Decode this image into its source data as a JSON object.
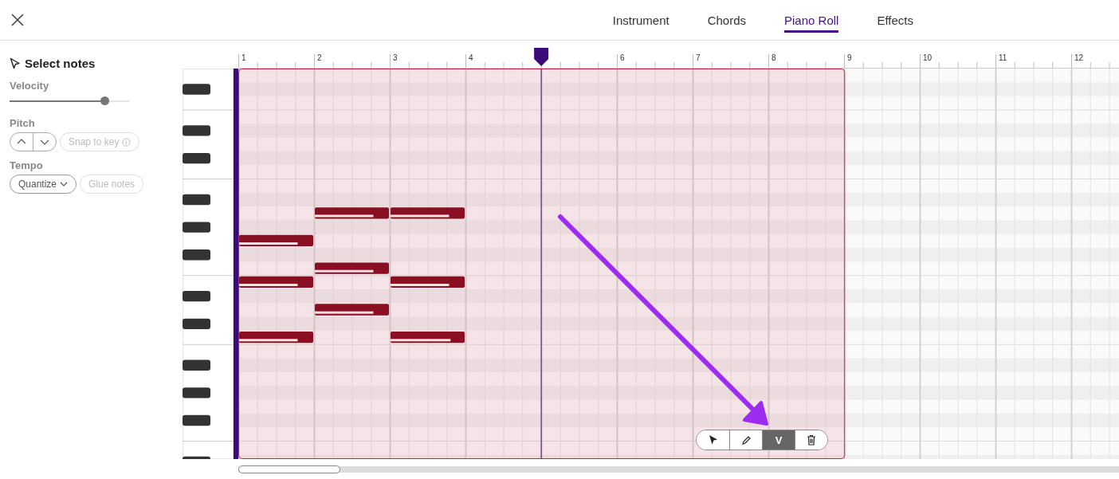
{
  "tabs": [
    {
      "label": "Instrument",
      "selected": false
    },
    {
      "label": "Chords",
      "selected": false
    },
    {
      "label": "Piano Roll",
      "selected": true
    },
    {
      "label": "Effects",
      "selected": false
    }
  ],
  "sidebar": {
    "title": "Select notes",
    "velocity": {
      "label": "Velocity",
      "level": 0.79
    },
    "pitch": {
      "label": "Pitch",
      "snap_button": {
        "label": "Snap to key",
        "disabled": true
      }
    },
    "tempo": {
      "label": "Tempo",
      "quantize_button": {
        "label": "Quantize",
        "disabled": false
      },
      "glue_button": {
        "label": "Glue notes",
        "disabled": true
      }
    }
  },
  "ruler": {
    "bars_before_playhead": [
      "1",
      "2",
      "3",
      "4"
    ],
    "bars_after_playhead": [
      "6",
      "7",
      "8",
      "9",
      "10",
      "11",
      "12"
    ],
    "playhead": {
      "level": 0.344
    }
  },
  "roll": {
    "selection": {
      "level": 0.688
    },
    "rows": [
      {
        "kind": "natural",
        "cells": [
          {
            "kind": "empty"
          },
          {
            "kind": "empty"
          },
          {
            "kind": "empty"
          }
        ]
      },
      {
        "kind": "sharp",
        "cells": [
          {
            "kind": "empty"
          },
          {
            "kind": "empty"
          },
          {
            "kind": "empty"
          }
        ]
      },
      {
        "kind": "natural",
        "cells": [
          {
            "kind": "empty"
          },
          {
            "kind": "empty"
          },
          {
            "kind": "empty"
          }
        ]
      },
      {
        "kind": "natural",
        "cells": [
          {
            "kind": "empty"
          },
          {
            "kind": "empty"
          },
          {
            "kind": "empty"
          }
        ]
      },
      {
        "kind": "sharp",
        "cells": [
          {
            "kind": "empty"
          },
          {
            "kind": "empty"
          },
          {
            "kind": "empty"
          }
        ]
      },
      {
        "kind": "natural",
        "cells": [
          {
            "kind": "empty"
          },
          {
            "kind": "empty"
          },
          {
            "kind": "empty"
          }
        ]
      },
      {
        "kind": "sharp",
        "cells": [
          {
            "kind": "empty"
          },
          {
            "kind": "empty"
          },
          {
            "kind": "empty"
          }
        ]
      },
      {
        "kind": "natural",
        "cells": [
          {
            "kind": "empty"
          },
          {
            "kind": "empty"
          },
          {
            "kind": "empty"
          }
        ]
      },
      {
        "kind": "natural",
        "cells": [
          {
            "kind": "empty"
          },
          {
            "kind": "empty"
          },
          {
            "kind": "empty"
          }
        ]
      },
      {
        "kind": "sharp",
        "cells": [
          {
            "kind": "empty"
          },
          {
            "kind": "empty"
          },
          {
            "kind": "empty"
          }
        ]
      },
      {
        "kind": "natural",
        "cells": [
          {
            "kind": "empty"
          },
          {
            "kind": "note",
            "level": 0.79
          },
          {
            "kind": "note",
            "level": 0.79
          }
        ]
      },
      {
        "kind": "sharp",
        "cells": [
          {
            "kind": "empty"
          },
          {
            "kind": "empty"
          },
          {
            "kind": "empty"
          }
        ]
      },
      {
        "kind": "natural",
        "cells": [
          {
            "kind": "note",
            "level": 0.79
          },
          {
            "kind": "empty"
          },
          {
            "kind": "empty"
          }
        ]
      },
      {
        "kind": "sharp",
        "cells": [
          {
            "kind": "empty"
          },
          {
            "kind": "empty"
          },
          {
            "kind": "empty"
          }
        ]
      },
      {
        "kind": "natural",
        "cells": [
          {
            "kind": "empty"
          },
          {
            "kind": "note",
            "level": 0.79
          },
          {
            "kind": "empty"
          }
        ]
      },
      {
        "kind": "natural",
        "cells": [
          {
            "kind": "note",
            "level": 0.79
          },
          {
            "kind": "empty"
          },
          {
            "kind": "note",
            "level": 0.79
          }
        ]
      },
      {
        "kind": "sharp",
        "cells": [
          {
            "kind": "empty"
          },
          {
            "kind": "empty"
          },
          {
            "kind": "empty"
          }
        ]
      },
      {
        "kind": "natural",
        "cells": [
          {
            "kind": "empty"
          },
          {
            "kind": "note",
            "level": 0.79
          },
          {
            "kind": "empty"
          }
        ]
      },
      {
        "kind": "sharp",
        "cells": [
          {
            "kind": "empty"
          },
          {
            "kind": "empty"
          },
          {
            "kind": "empty"
          }
        ]
      },
      {
        "kind": "natural",
        "cells": [
          {
            "kind": "note",
            "level": 0.79
          },
          {
            "kind": "empty"
          },
          {
            "kind": "note",
            "level": 0.81
          }
        ]
      },
      {
        "kind": "natural",
        "cells": [
          {
            "kind": "empty"
          },
          {
            "kind": "empty"
          },
          {
            "kind": "empty"
          }
        ]
      },
      {
        "kind": "sharp",
        "cells": [
          {
            "kind": "empty"
          },
          {
            "kind": "empty"
          },
          {
            "kind": "empty"
          }
        ]
      },
      {
        "kind": "natural",
        "cells": [
          {
            "kind": "empty"
          },
          {
            "kind": "empty"
          },
          {
            "kind": "empty"
          }
        ]
      },
      {
        "kind": "sharp",
        "cells": [
          {
            "kind": "empty"
          },
          {
            "kind": "empty"
          },
          {
            "kind": "empty"
          }
        ]
      },
      {
        "kind": "natural",
        "cells": [
          {
            "kind": "empty"
          },
          {
            "kind": "empty"
          },
          {
            "kind": "empty"
          }
        ]
      },
      {
        "kind": "sharp",
        "cells": [
          {
            "kind": "empty"
          },
          {
            "kind": "empty"
          },
          {
            "kind": "empty"
          }
        ]
      },
      {
        "kind": "natural",
        "cells": [
          {
            "kind": "empty"
          },
          {
            "kind": "empty"
          },
          {
            "kind": "empty"
          }
        ]
      },
      {
        "kind": "natural",
        "cells": [
          {
            "kind": "empty"
          },
          {
            "kind": "empty"
          },
          {
            "kind": "empty"
          }
        ]
      },
      {
        "kind": "sharp",
        "cells": [
          {
            "kind": "empty"
          },
          {
            "kind": "empty"
          },
          {
            "kind": "empty"
          }
        ]
      }
    ]
  },
  "tools": [
    {
      "kind": "pointer",
      "selected": false
    },
    {
      "kind": "pencil",
      "selected": false
    },
    {
      "kind": "velocity",
      "label": "V",
      "selected": true
    },
    {
      "kind": "trash",
      "selected": false
    }
  ]
}
